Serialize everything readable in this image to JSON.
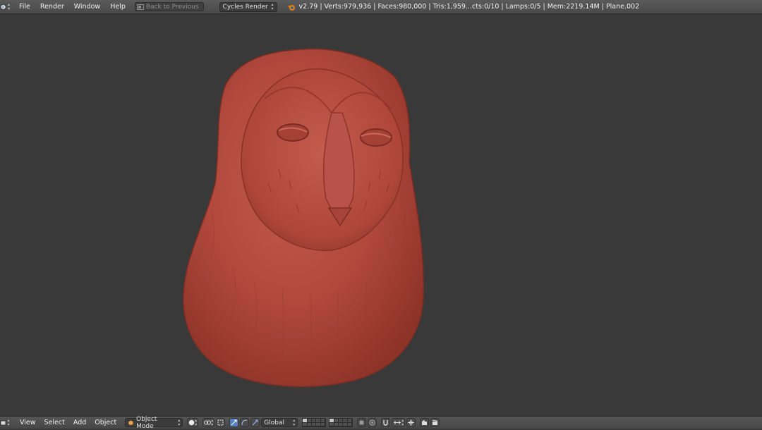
{
  "topbar": {
    "menus": [
      "File",
      "Render",
      "Window",
      "Help"
    ],
    "back_to_previous": "Back to Previous",
    "render_engine": "Cycles Render",
    "stats": "v2.79 | Verts:979,936 | Faces:980,000 | Tris:1,959...cts:0/10 | Lamps:0/5 | Mem:2219.14M | Plane.002"
  },
  "bottombar": {
    "menus": [
      "View",
      "Select",
      "Add",
      "Object"
    ],
    "mode": "Object Mode",
    "orientation": "Global"
  },
  "colors": {
    "header_bg": "#4f4f4f",
    "viewport_bg": "#393939",
    "clay": "#b0483c",
    "active_button": "#5680c2"
  },
  "icons": {
    "editor_type": "3d-view-icon",
    "engine": "blender-logo-icon",
    "viewport_shading": "solid-shading-icon",
    "pivot": "pivot-point-icon",
    "manipulator": "manipulator-icon",
    "snap": "magnet-icon",
    "render_preview": "camera-render-icon"
  }
}
